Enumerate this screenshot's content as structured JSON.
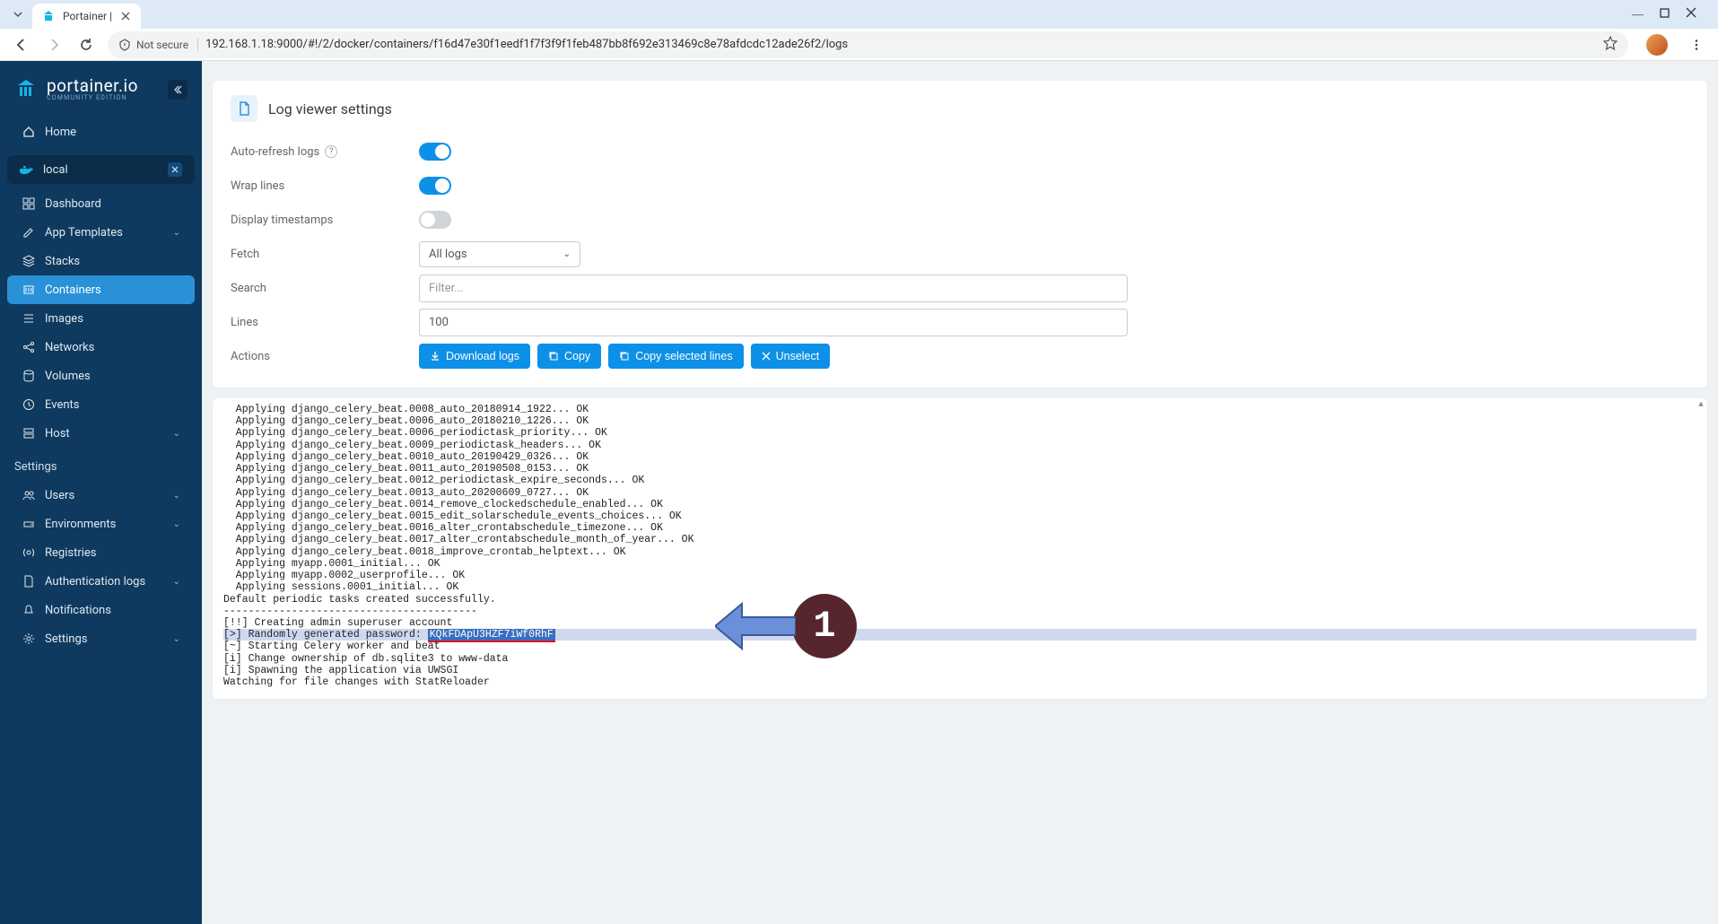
{
  "browser": {
    "tab_title": "Portainer |",
    "security_label": "Not secure",
    "url": "192.168.1.18:9000/#!/2/docker/containers/f16d47e30f1eedf1f7f3f9f1feb487bb8f692e313469c8e78afdcdc12ade26f2/logs"
  },
  "logo": {
    "name": "portainer.io",
    "edition": "COMMUNITY EDITION"
  },
  "nav": {
    "home": "Home",
    "env_name": "local",
    "dashboard": "Dashboard",
    "app_templates": "App Templates",
    "stacks": "Stacks",
    "containers": "Containers",
    "images": "Images",
    "networks": "Networks",
    "volumes": "Volumes",
    "events": "Events",
    "host": "Host",
    "settings_header": "Settings",
    "users": "Users",
    "environments": "Environments",
    "registries": "Registries",
    "auth_logs": "Authentication logs",
    "notifications": "Notifications",
    "settings": "Settings"
  },
  "panel": {
    "title": "Log viewer settings",
    "auto_refresh": "Auto-refresh logs",
    "wrap_lines": "Wrap lines",
    "timestamps": "Display timestamps",
    "fetch": "Fetch",
    "fetch_value": "All logs",
    "search": "Search",
    "search_placeholder": "Filter...",
    "lines": "Lines",
    "lines_value": "100",
    "actions": "Actions",
    "download": "Download logs",
    "copy": "Copy",
    "copy_selected": "Copy selected lines",
    "unselect": "Unselect"
  },
  "logs": [
    "  Applying django_celery_beat.0008_auto_20180914_1922... OK",
    "  Applying django_celery_beat.0006_auto_20180210_1226... OK",
    "  Applying django_celery_beat.0006_periodictask_priority... OK",
    "  Applying django_celery_beat.0009_periodictask_headers... OK",
    "  Applying django_celery_beat.0010_auto_20190429_0326... OK",
    "  Applying django_celery_beat.0011_auto_20190508_0153... OK",
    "  Applying django_celery_beat.0012_periodictask_expire_seconds... OK",
    "  Applying django_celery_beat.0013_auto_20200609_0727... OK",
    "  Applying django_celery_beat.0014_remove_clockedschedule_enabled... OK",
    "  Applying django_celery_beat.0015_edit_solarschedule_events_choices... OK",
    "  Applying django_celery_beat.0016_alter_crontabschedule_timezone... OK",
    "  Applying django_celery_beat.0017_alter_crontabschedule_month_of_year... OK",
    "  Applying django_celery_beat.0018_improve_crontab_helptext... OK",
    "  Applying myapp.0001_initial... OK",
    "  Applying myapp.0002_userprofile... OK",
    "  Applying sessions.0001_initial... OK",
    "Default periodic tasks created successfully.",
    "-----------------------------------------",
    "[!!] Creating admin superuser account"
  ],
  "log_password_line": {
    "prefix": "[>] Randomly generated password: ",
    "value": "KQkFDApU3HZF7iWf0RhF"
  },
  "logs_after": [
    "[~] Starting Celery worker and beat",
    "[i] Change ownership of db.sqlite3 to www-data",
    "[i] Spawning the application via UWSGI",
    "Watching for file changes with StatReloader"
  ],
  "annotation": {
    "number": "1"
  }
}
